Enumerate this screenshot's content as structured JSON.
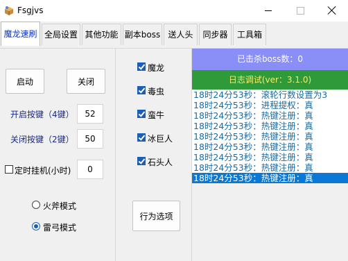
{
  "window": {
    "title": "Fsgjvs",
    "app_icon": "app-icon"
  },
  "tabs": [
    {
      "label": "魔龙速刷",
      "active": true
    },
    {
      "label": "全局设置",
      "active": false
    },
    {
      "label": "其他功能",
      "active": false
    },
    {
      "label": "副本boss",
      "active": false
    },
    {
      "label": "送人头",
      "active": false
    },
    {
      "label": "同步器",
      "active": false
    },
    {
      "label": "工具箱",
      "active": false
    }
  ],
  "controls": {
    "start_label": "启动",
    "stop_label": "关闭",
    "start_key_label": "开启按键（4键）",
    "start_key_value": "52",
    "stop_key_label": "关闭按键（2键）",
    "stop_key_value": "50",
    "timer_label": "定时挂机(小时)",
    "timer_checked": false,
    "timer_value": "0",
    "mode_axe_label": "火斧模式",
    "mode_bow_label": "雷弓模式",
    "mode_selected": "雷弓模式"
  },
  "targets": [
    {
      "label": "魔龙",
      "checked": true
    },
    {
      "label": "毒虫",
      "checked": true
    },
    {
      "label": "蛮牛",
      "checked": true
    },
    {
      "label": "冰巨人",
      "checked": true
    },
    {
      "label": "石头人",
      "checked": true
    }
  ],
  "behavior_button": "行为选项",
  "status": {
    "boss_kills": "已击杀boss数：0",
    "debug_log": "日志调试(ver：3.1.0)",
    "kill_bar_color": "#8a8ef7",
    "debug_bar_color": "#2f9a3a"
  },
  "log_lines": [
    "18时24分53秒：滚轮行数设置为3",
    "18时24分53秒：进程提权：真",
    "18时24分53秒：热键注册：真",
    "18时24分53秒：热键注册：真",
    "18时24分53秒：热键注册：真",
    "18时24分53秒：热键注册：真",
    "18时24分53秒：热键注册：真",
    "18时24分53秒：热键注册：真",
    "18时24分53秒：热键注册：真"
  ]
}
